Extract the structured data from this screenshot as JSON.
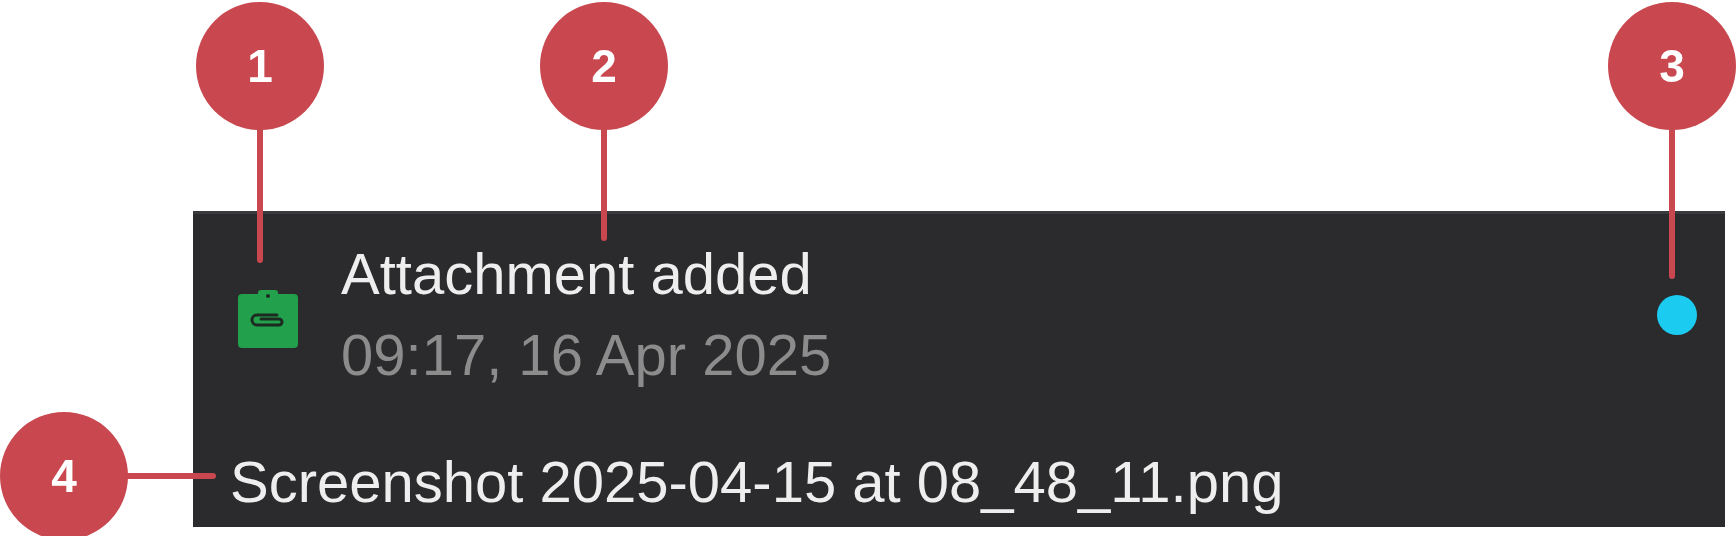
{
  "notification": {
    "title": "Attachment added",
    "time": "09:17, 16 Apr 2025",
    "unread": true,
    "file_name": "Screenshot 2025-04-15 at 08_48_11.png"
  },
  "callouts": [
    {
      "number": "1",
      "kind": "down"
    },
    {
      "number": "2",
      "kind": "down"
    },
    {
      "number": "3",
      "kind": "down"
    },
    {
      "number": "4",
      "kind": "right"
    }
  ]
}
